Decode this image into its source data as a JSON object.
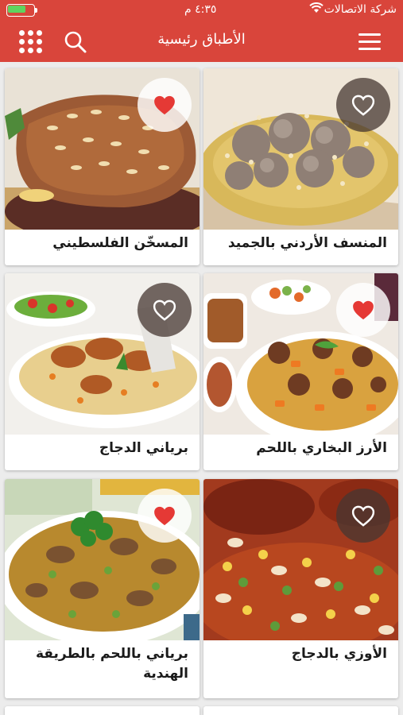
{
  "status_bar": {
    "carrier": "شركة الاتصالات",
    "time": "٤:٣٥ م"
  },
  "header": {
    "title": "الأطباق رئيسية"
  },
  "dishes": [
    {
      "title": "المنسف الأردني بالجميد",
      "favorite": false
    },
    {
      "title": "المسخّن الفلسطيني",
      "favorite": true
    },
    {
      "title": "الأرز البخاري باللحم",
      "favorite": true
    },
    {
      "title": "برياني الدجاج",
      "favorite": false
    },
    {
      "title": "الأوزي بالدجاج",
      "favorite": false
    },
    {
      "title": "برياني باللحم بالطريقة الهندية",
      "favorite": true
    }
  ],
  "colors": {
    "brand": "#d9453b",
    "heart_active": "#e53935"
  }
}
